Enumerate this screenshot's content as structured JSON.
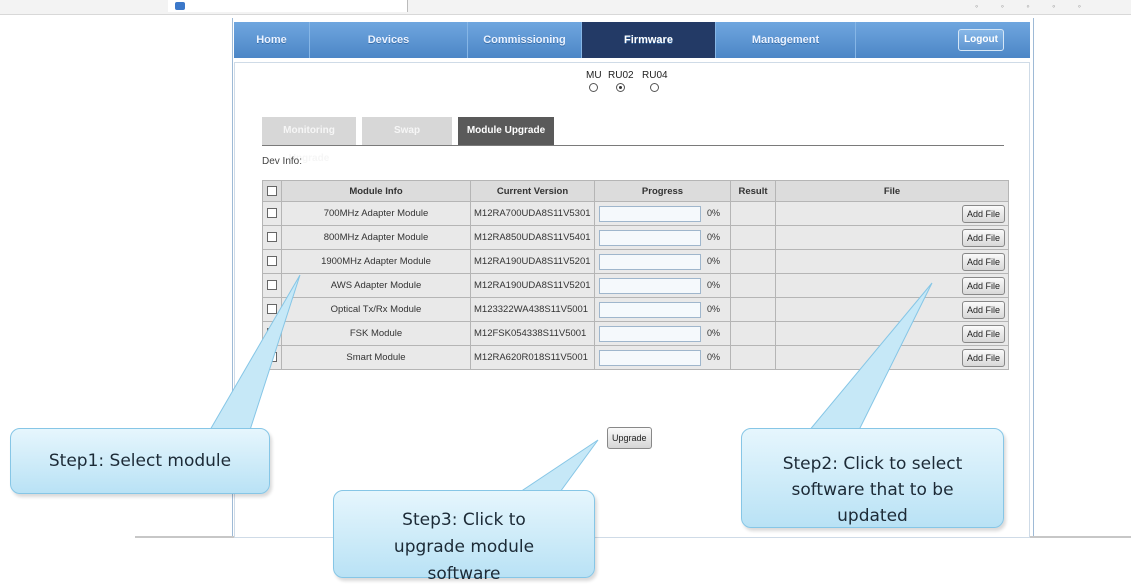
{
  "nav": {
    "items": [
      "Home",
      "Devices",
      "Commissioning",
      "Firmware",
      "Management"
    ],
    "active_index": 3,
    "logout_label": "Logout"
  },
  "units": {
    "options": [
      "MU",
      "RU02",
      "RU04"
    ],
    "selected": "RU02"
  },
  "tabs": {
    "items": [
      "Monitoring Upgrade",
      "Swap",
      "Module Upgrade"
    ],
    "active": "Module Upgrade"
  },
  "dev_info_label": "Dev Info:",
  "table": {
    "headers": [
      "Module Info",
      "Current Version",
      "Progress",
      "Result",
      "File"
    ],
    "add_file_label": "Add File",
    "rows": [
      {
        "module": "700MHz Adapter Module",
        "version": "M12RA700UDA8S11V5301",
        "progress": 0,
        "progress_text": "0%",
        "result": ""
      },
      {
        "module": "800MHz Adapter Module",
        "version": "M12RA850UDA8S11V5401",
        "progress": 0,
        "progress_text": "0%",
        "result": ""
      },
      {
        "module": "1900MHz Adapter Module",
        "version": "M12RA190UDA8S11V5201",
        "progress": 0,
        "progress_text": "0%",
        "result": ""
      },
      {
        "module": "AWS Adapter Module",
        "version": "M12RA190UDA8S11V5201",
        "progress": 0,
        "progress_text": "0%",
        "result": ""
      },
      {
        "module": "Optical Tx/Rx Module",
        "version": "M123322WA438S11V5001",
        "progress": 0,
        "progress_text": "0%",
        "result": ""
      },
      {
        "module": "FSK Module",
        "version": "M12FSK054338S11V5001",
        "progress": 0,
        "progress_text": "0%",
        "result": ""
      },
      {
        "module": "Smart Module",
        "version": "M12RA620R018S11V5001",
        "progress": 0,
        "progress_text": "0%",
        "result": ""
      }
    ]
  },
  "upgrade_label": "Upgrade",
  "callouts": {
    "step1": "Step1: Select module",
    "step2": "Step2: Click to select software that to be updated",
    "step3": "Step3: Click to upgrade module software"
  },
  "colors": {
    "nav_bar": "#5a92cf",
    "nav_active": "#233a66",
    "tab_active": "#5a5a5a",
    "callout_fill": "#c6e8f7",
    "callout_border": "#86c6e6"
  }
}
